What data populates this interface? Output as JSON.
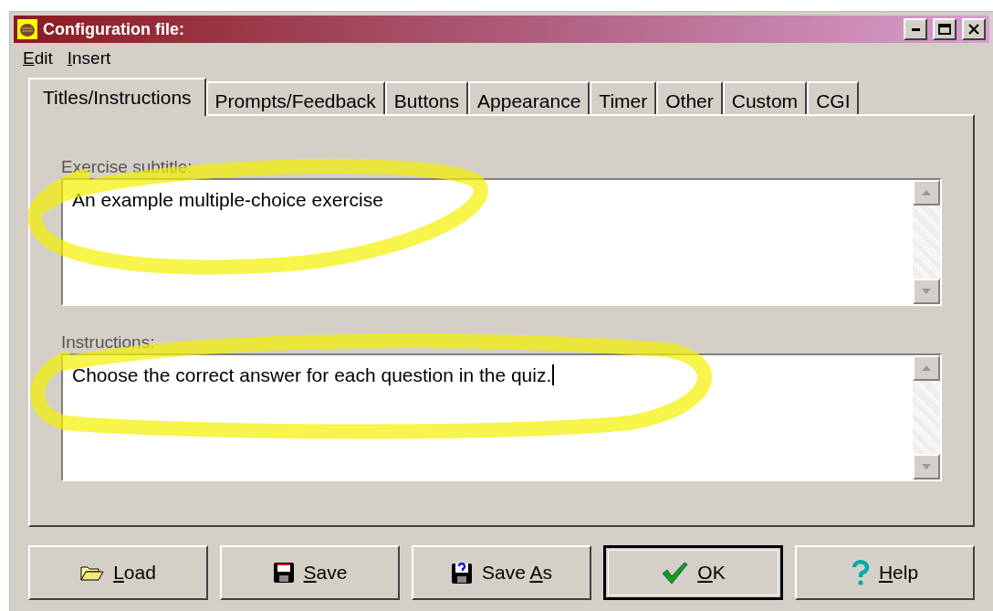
{
  "window": {
    "title": "Configuration file:"
  },
  "menu": [
    {
      "parts": [
        {
          "text": "E",
          "underline": true
        },
        {
          "text": "dit",
          "underline": false
        }
      ]
    },
    {
      "parts": [
        {
          "text": "I",
          "underline": true
        },
        {
          "text": "nsert",
          "underline": false
        }
      ]
    }
  ],
  "tabs": [
    {
      "label": "Titles/Instructions",
      "selected": true
    },
    {
      "label": "Prompts/Feedback",
      "selected": false
    },
    {
      "label": "Buttons",
      "selected": false
    },
    {
      "label": "Appearance",
      "selected": false
    },
    {
      "label": "Timer",
      "selected": false
    },
    {
      "label": "Other",
      "selected": false
    },
    {
      "label": "Custom",
      "selected": false
    },
    {
      "label": "CGI",
      "selected": false
    }
  ],
  "fields": [
    {
      "label": "Exercise subtitle:",
      "value": "An example multiple-choice exercise",
      "focused": false
    },
    {
      "label": "Instructions:",
      "value": "Choose the correct answer for each question in the quiz.",
      "focused": true
    }
  ],
  "buttons": [
    {
      "parts": [
        {
          "text": "L",
          "underline": true
        },
        {
          "text": "oad",
          "underline": false
        }
      ],
      "kind": "load",
      "default": false
    },
    {
      "parts": [
        {
          "text": "S",
          "underline": true
        },
        {
          "text": "ave",
          "underline": false
        }
      ],
      "kind": "save",
      "default": false
    },
    {
      "parts": [
        {
          "text": "Save ",
          "underline": false
        },
        {
          "text": "A",
          "underline": true
        },
        {
          "text": "s",
          "underline": false
        }
      ],
      "kind": "saveas",
      "default": false
    },
    {
      "parts": [
        {
          "text": "O",
          "underline": true
        },
        {
          "text": "K",
          "underline": false
        }
      ],
      "kind": "ok",
      "default": true
    },
    {
      "parts": [
        {
          "text": "H",
          "underline": true
        },
        {
          "text": "elp",
          "underline": false
        }
      ],
      "kind": "help",
      "default": false
    }
  ]
}
